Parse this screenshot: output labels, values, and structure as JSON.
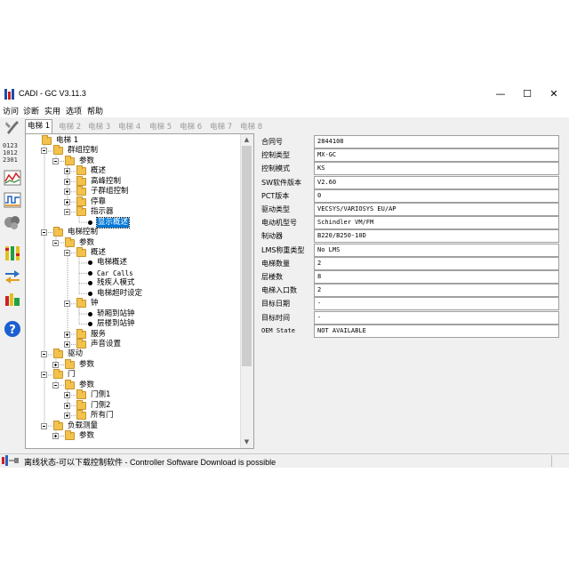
{
  "window": {
    "title": "CADI - GC V3.11.3",
    "minimize": "—",
    "maximize": "☐",
    "close": "✕"
  },
  "menu": [
    "访问",
    "诊断",
    "实用",
    "选项",
    "帮助"
  ],
  "tabs": [
    {
      "label": "电梯 1",
      "active": true
    },
    {
      "label": "电梯 2",
      "active": false
    },
    {
      "label": "电梯 3",
      "active": false
    },
    {
      "label": "电梯 4",
      "active": false
    },
    {
      "label": "电梯 5",
      "active": false
    },
    {
      "label": "电梯 6",
      "active": false
    },
    {
      "label": "电梯 7",
      "active": false
    },
    {
      "label": "电梯 8",
      "active": false
    }
  ],
  "tree": [
    {
      "label": "电梯 1",
      "level": 0,
      "kind": "folder",
      "expander": "none"
    },
    {
      "label": "群组控制",
      "level": 1,
      "kind": "folder",
      "expander": "minus"
    },
    {
      "label": "参数",
      "level": 2,
      "kind": "folder",
      "expander": "minus"
    },
    {
      "label": "概述",
      "level": 3,
      "kind": "folder",
      "expander": "plus"
    },
    {
      "label": "高峰控制",
      "level": 3,
      "kind": "folder",
      "expander": "plus"
    },
    {
      "label": "子群组控制",
      "level": 3,
      "kind": "folder",
      "expander": "plus"
    },
    {
      "label": "停靠",
      "level": 3,
      "kind": "folder",
      "expander": "plus"
    },
    {
      "label": "指示器",
      "level": 3,
      "kind": "folder",
      "expander": "minus"
    },
    {
      "label": "显示概述",
      "level": 4,
      "kind": "bullet",
      "selected": true
    },
    {
      "label": "电梯控制",
      "level": 1,
      "kind": "folder",
      "expander": "minus"
    },
    {
      "label": "参数",
      "level": 2,
      "kind": "folder",
      "expander": "minus"
    },
    {
      "label": "概述",
      "level": 3,
      "kind": "folder",
      "expander": "minus"
    },
    {
      "label": "电梯概述",
      "level": 4,
      "kind": "bullet"
    },
    {
      "label": "Car Calls",
      "level": 4,
      "kind": "bullet",
      "mono": true
    },
    {
      "label": "残疾人模式",
      "level": 4,
      "kind": "bullet"
    },
    {
      "label": "电梯超时设定",
      "level": 4,
      "kind": "bullet"
    },
    {
      "label": "钟",
      "level": 3,
      "kind": "folder",
      "expander": "minus"
    },
    {
      "label": "轿厢到站钟",
      "level": 4,
      "kind": "bullet"
    },
    {
      "label": "层楼到站钟",
      "level": 4,
      "kind": "bullet"
    },
    {
      "label": "服务",
      "level": 3,
      "kind": "folder",
      "expander": "plus"
    },
    {
      "label": "声音设置",
      "level": 3,
      "kind": "folder",
      "expander": "plus"
    },
    {
      "label": "驱动",
      "level": 1,
      "kind": "folder",
      "expander": "minus"
    },
    {
      "label": "参数",
      "level": 2,
      "kind": "folder",
      "expander": "plus"
    },
    {
      "label": "门",
      "level": 1,
      "kind": "folder",
      "expander": "minus"
    },
    {
      "label": "参数",
      "level": 2,
      "kind": "folder",
      "expander": "minus"
    },
    {
      "label": "门侧1",
      "level": 3,
      "kind": "folder",
      "expander": "plus"
    },
    {
      "label": "门侧2",
      "level": 3,
      "kind": "folder",
      "expander": "plus"
    },
    {
      "label": "所有门",
      "level": 3,
      "kind": "folder",
      "expander": "plus"
    },
    {
      "label": "负载测量",
      "level": 1,
      "kind": "folder",
      "expander": "minus"
    },
    {
      "label": "参数",
      "level": 2,
      "kind": "folder",
      "expander": "plus"
    }
  ],
  "properties": [
    {
      "key": "合同号",
      "value": "2844108"
    },
    {
      "key": "控制类型",
      "value": "MX-GC"
    },
    {
      "key": "控制模式",
      "value": "KS"
    },
    {
      "key": "SW软件版本",
      "value": "V2.60"
    },
    {
      "key": "PCT版本",
      "value": "0"
    },
    {
      "key": "驱动类型",
      "value": "VECSYS/VARIOSYS EU/AP"
    },
    {
      "key": "电动机型号",
      "value": "Schindler VM/FM"
    },
    {
      "key": "制动器",
      "value": "B220/B250-10D"
    },
    {
      "key": "LMS称重类型",
      "value": "No LMS"
    },
    {
      "key": "电梯数量",
      "value": "2"
    },
    {
      "key": "层楼数",
      "value": "8"
    },
    {
      "key": "电梯入口数",
      "value": "2"
    },
    {
      "key": "目标日期",
      "value": "-"
    },
    {
      "key": "目标时间",
      "value": "-"
    },
    {
      "key": "OEM State",
      "value": "NOT AVAILABLE",
      "mono": true
    }
  ],
  "status": {
    "text": "离线状态-可以下载控制软件 - Controller Software Download is possible"
  },
  "toolbar_icons": [
    "tools-icon",
    "numbers-icon",
    "chart-icon",
    "graph-icon",
    "network-icon",
    "floor-icon",
    "transfer-icon",
    "download-icon",
    "help-icon"
  ],
  "colors": {
    "folder": "#f3c24c",
    "selection": "#0078d7",
    "help": "#1c5fd0"
  }
}
